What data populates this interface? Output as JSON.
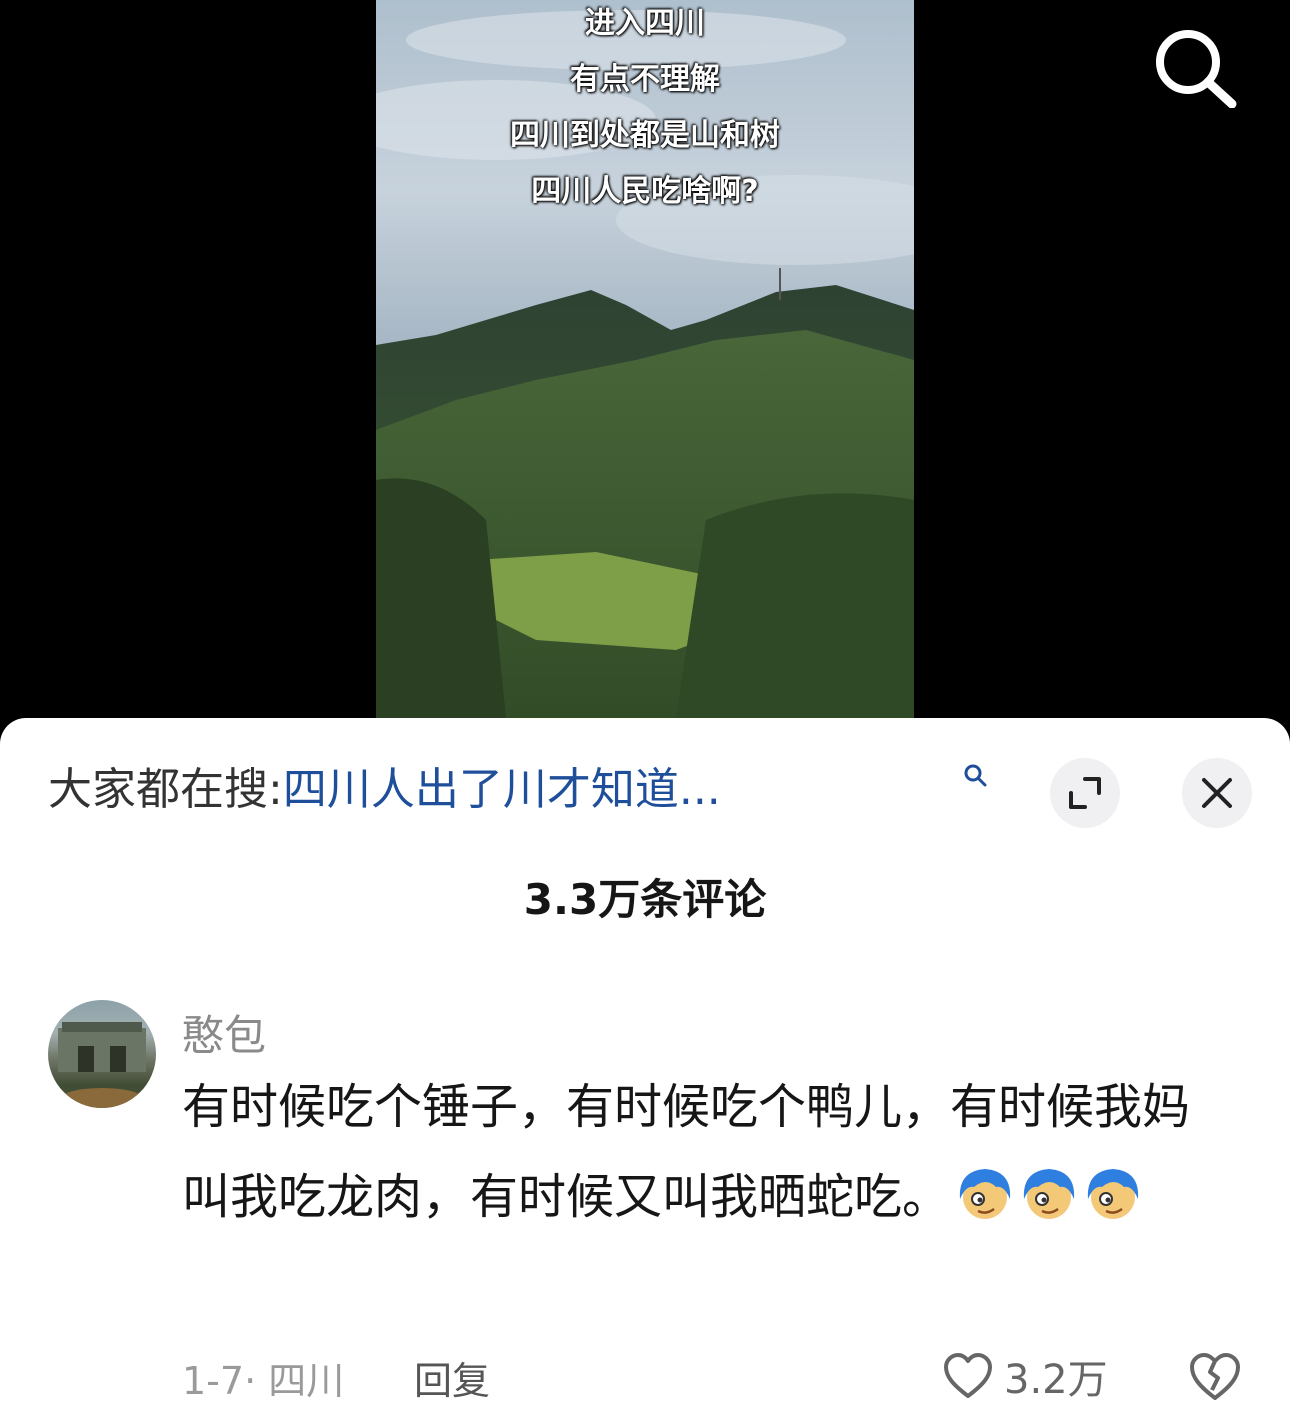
{
  "video": {
    "caption_lines": [
      "进入四川",
      "有点不理解",
      "四川到处都是山和树",
      "四川人民吃啥啊?"
    ]
  },
  "icons": {
    "search": "search-icon",
    "expand": "expand-icon",
    "close": "close-icon",
    "heart": "heart-icon",
    "dislike": "broken-heart-icon"
  },
  "sheet": {
    "hot_search_label": "大家都在搜:",
    "hot_search_query": "四川人出了川才知道...",
    "comment_count": "3.3万条评论"
  },
  "comment": {
    "username": "憨包",
    "text": "有时候吃个锤子，有时候吃个鸭儿，有时候我妈叫我吃龙肉，有时候又叫我晒蛇吃。",
    "emojis": [
      "blue-hair-face-emoji",
      "blue-hair-face-emoji",
      "blue-hair-face-emoji"
    ],
    "date": "1-7",
    "location": "四川",
    "reply_label": "回复",
    "like_count": "3.2万"
  },
  "colors": {
    "link_blue": "#1f4f9a",
    "emoji_hair": "#2f7fe0"
  }
}
